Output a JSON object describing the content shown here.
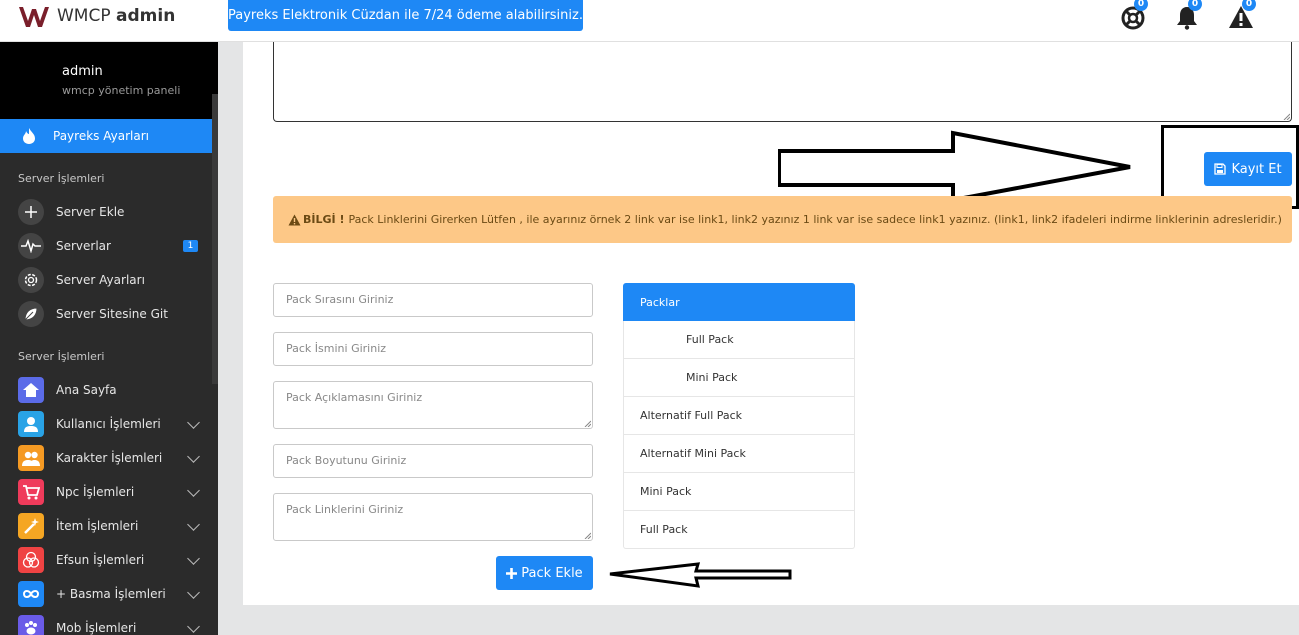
{
  "header": {
    "brand_light": "WMCP",
    "brand_bold": "admin",
    "announcement": "Payreks Elektronik Cüzdan ile 7/24 ödeme alabilirsiniz.",
    "icons": [
      {
        "name": "lifebuoy-icon",
        "badge": "0"
      },
      {
        "name": "bell-icon",
        "badge": "0"
      },
      {
        "name": "warning-icon",
        "badge": "0"
      }
    ]
  },
  "sidebar": {
    "username": "admin",
    "subtitle": "wmcp yönetim paneli",
    "active_item": "Payreks Ayarları",
    "section1": "Server İşlemleri",
    "items1": [
      {
        "label": "Server Ekle",
        "icon": "plus-icon"
      },
      {
        "label": "Serverlar",
        "icon": "pulse-icon",
        "badge": "1"
      },
      {
        "label": "Server Ayarları",
        "icon": "gear-icon"
      },
      {
        "label": "Server Sitesine Git",
        "icon": "leaf-icon"
      }
    ],
    "section2": "Server İşlemleri",
    "items2": [
      {
        "label": "Ana Sayfa",
        "icon": "home-icon",
        "color": "#5b6be8"
      },
      {
        "label": "Kullanıcı İşlemleri",
        "icon": "user-icon",
        "color": "#29a3e6"
      },
      {
        "label": "Karakter İşlemleri",
        "icon": "users-icon",
        "color": "#f59a23"
      },
      {
        "label": "Npc İşlemleri",
        "icon": "cart-icon",
        "color": "#ef3b5b"
      },
      {
        "label": "İtem İşlemleri",
        "icon": "wand-icon",
        "color": "#f5a623"
      },
      {
        "label": "Efsun İşlemleri",
        "icon": "circles-icon",
        "color": "#ef4343"
      },
      {
        "label": "+ Basma İşlemleri",
        "icon": "infinity-icon",
        "color": "#1e88f5"
      },
      {
        "label": "Mob İşlemleri",
        "icon": "paw-icon",
        "color": "#6a5be8"
      }
    ]
  },
  "main": {
    "save_label": "Kayıt Et",
    "alert_title": "BİLGİ !",
    "alert_text": "Pack Linklerini Girerken Lütfen , ile ayarınız örnek 2 link var ise link1, link2 yazınız 1 link var ise sadece link1 yazınız. (link1, link2 ifadeleri indirme linklerinin adresleridir.)",
    "form": {
      "order_placeholder": "Pack Sırasını Giriniz",
      "name_placeholder": "Pack İsmini Giriniz",
      "desc_placeholder": "Pack Açıklamasını Giriniz",
      "size_placeholder": "Pack Boyutunu Giriniz",
      "links_placeholder": "Pack Linklerini Giriniz",
      "add_label": "Pack Ekle"
    },
    "packs": {
      "header": "Packlar",
      "items": [
        "Full Pack",
        "Mini Pack",
        "Alternatif Full Pack",
        "Alternatif Mini Pack",
        "Mini Pack",
        "Full Pack"
      ]
    }
  }
}
